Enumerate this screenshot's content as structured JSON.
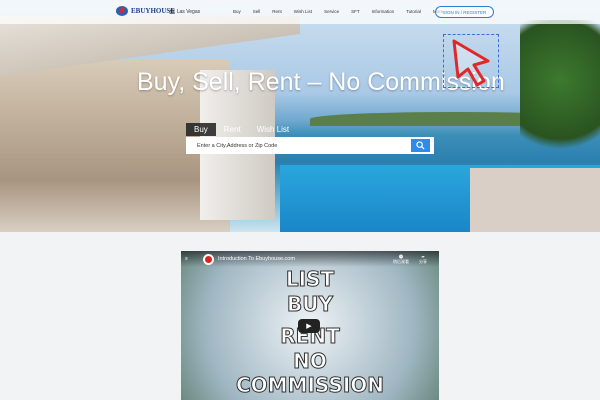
{
  "nav": {
    "brand": "EBUYHOUSE",
    "location": "Las Vegas",
    "menu": [
      "Buy",
      "Sell",
      "Rent",
      "Wish List",
      "Service",
      "SFT",
      "Information",
      "Tutorial",
      "More"
    ],
    "signin": "SIGN IN / REGISTER"
  },
  "hero": {
    "headline": "Buy, Sell, Rent – No Commission",
    "tabs": [
      "Buy",
      "Rent",
      "Wish List"
    ],
    "active_tab": "Buy",
    "search_placeholder": "Enter a City,Address or Zip Code",
    "accent": "#2d8ceb"
  },
  "video": {
    "title": "Introduction To Ebuyhouse.com",
    "watch_later": "稍后观看",
    "share": "分享",
    "lines": [
      "LIST",
      "BUY",
      "RENT",
      "NO",
      "COMMISSION"
    ]
  }
}
